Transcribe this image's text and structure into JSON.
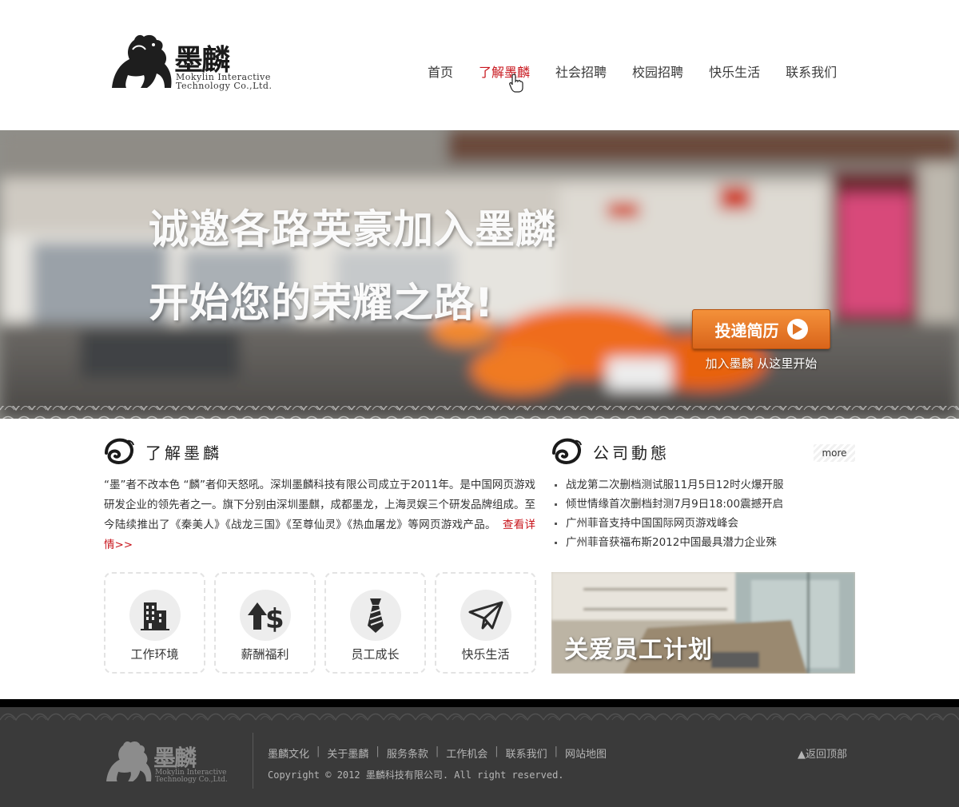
{
  "header": {
    "logo_cn": "墨麟",
    "logo_en_line1": "Mokylin Interactive",
    "logo_en_line2": "Technology Co.,Ltd.",
    "nav": [
      "首页",
      "了解墨麟",
      "社会招聘",
      "校园招聘",
      "快乐生活",
      "联系我们"
    ],
    "active_nav": "了解墨麟"
  },
  "banner": {
    "title_line1": "诚邀各路英豪加入墨麟",
    "title_line2": "开始您的荣耀之路!",
    "button_label": "投递简历",
    "button_sub": "加入墨麟 从这里开始"
  },
  "about": {
    "title": "了解墨麟",
    "text": "“墨”者不改本色 “麟”者仰天怒吼。深圳墨麟科技有限公司成立于2011年。是中国网页游戏研发企业的领先者之一。旗下分别由深圳墨麒，成都墨龙，上海灵娱三个研发品牌组成。至今陆续推出了《秦美人》《战龙三国》《至尊仙灵》《热血屠龙》等网页游戏产品。",
    "more_label": "查看详情>>"
  },
  "tiles": [
    {
      "label": "工作环境",
      "icon": "building-icon"
    },
    {
      "label": "薪酬福利",
      "icon": "salary-arrow-icon"
    },
    {
      "label": "员工成长",
      "icon": "tie-icon"
    },
    {
      "label": "快乐生活",
      "icon": "paper-plane-icon"
    }
  ],
  "news": {
    "title": "公司動態",
    "more_label": "more",
    "items": [
      "战龙第二次删档测试服11月5日12时火爆开服",
      "倾世情缘首次删档封测7月9日18:00震撼开启",
      "广州菲音支持中国国际网页游戏峰会",
      "广州菲音获福布斯2012中国最具潜力企业殊"
    ]
  },
  "care": {
    "title": "关爱员工计划"
  },
  "footer": {
    "logo_cn": "墨麟",
    "logo_en_line1": "Mokylin Interactive",
    "logo_en_line2": "Technology Co.,Ltd.",
    "links": [
      "墨麟文化",
      "关于墨麟",
      "服务条款",
      "工作机会",
      "联系我们",
      "网站地图"
    ],
    "separator": "|",
    "copyright": "Copyright © 2012 墨麟科技有限公司. All right reserved.",
    "back_top": "▲返回顶部"
  },
  "colors": {
    "accent_red": "#c8161d",
    "button_orange": "#e67a2a",
    "footer_bg": "#3a3a3a"
  }
}
